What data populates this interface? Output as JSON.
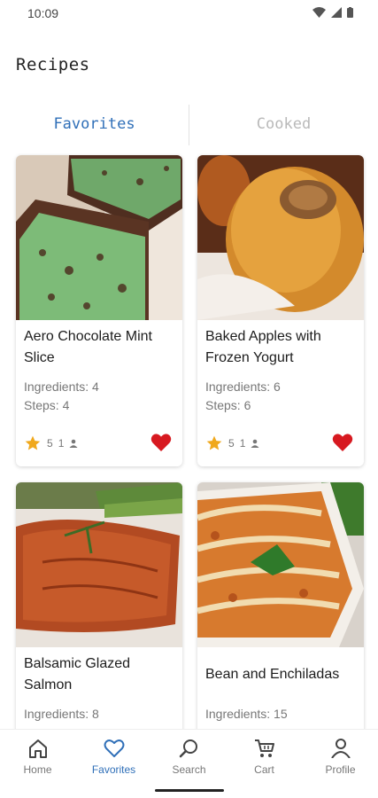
{
  "status": {
    "time": "10:09"
  },
  "page": {
    "title": "Recipes"
  },
  "tabs": [
    {
      "label": "Favorites",
      "active": true
    },
    {
      "label": "Cooked",
      "active": false
    }
  ],
  "recipes": [
    {
      "title": "Aero Chocolate Mint Slice",
      "ingredients": "Ingredients: 4",
      "steps": "Steps: 4",
      "rating": "5",
      "users": "1",
      "favorite": true
    },
    {
      "title": "Baked Apples with Frozen Yogurt",
      "ingredients": "Ingredients: 6",
      "steps": "Steps: 6",
      "rating": "5",
      "users": "1",
      "favorite": true
    },
    {
      "title": "Balsamic Glazed Salmon",
      "ingredients": "Ingredients: 8",
      "steps": "",
      "rating": "",
      "users": "",
      "favorite": true
    },
    {
      "title": "Bean and Enchiladas",
      "ingredients": "Ingredients: 15",
      "steps": "",
      "rating": "",
      "users": "",
      "favorite": true
    }
  ],
  "nav": [
    {
      "label": "Home",
      "icon": "home-icon"
    },
    {
      "label": "Favorites",
      "icon": "heart-icon",
      "active": true
    },
    {
      "label": "Search",
      "icon": "search-icon"
    },
    {
      "label": "Cart",
      "icon": "cart-icon"
    },
    {
      "label": "Profile",
      "icon": "person-icon"
    }
  ],
  "colors": {
    "accent": "#2f6fb8",
    "heart": "#d71920",
    "star": "#f0a81c"
  }
}
